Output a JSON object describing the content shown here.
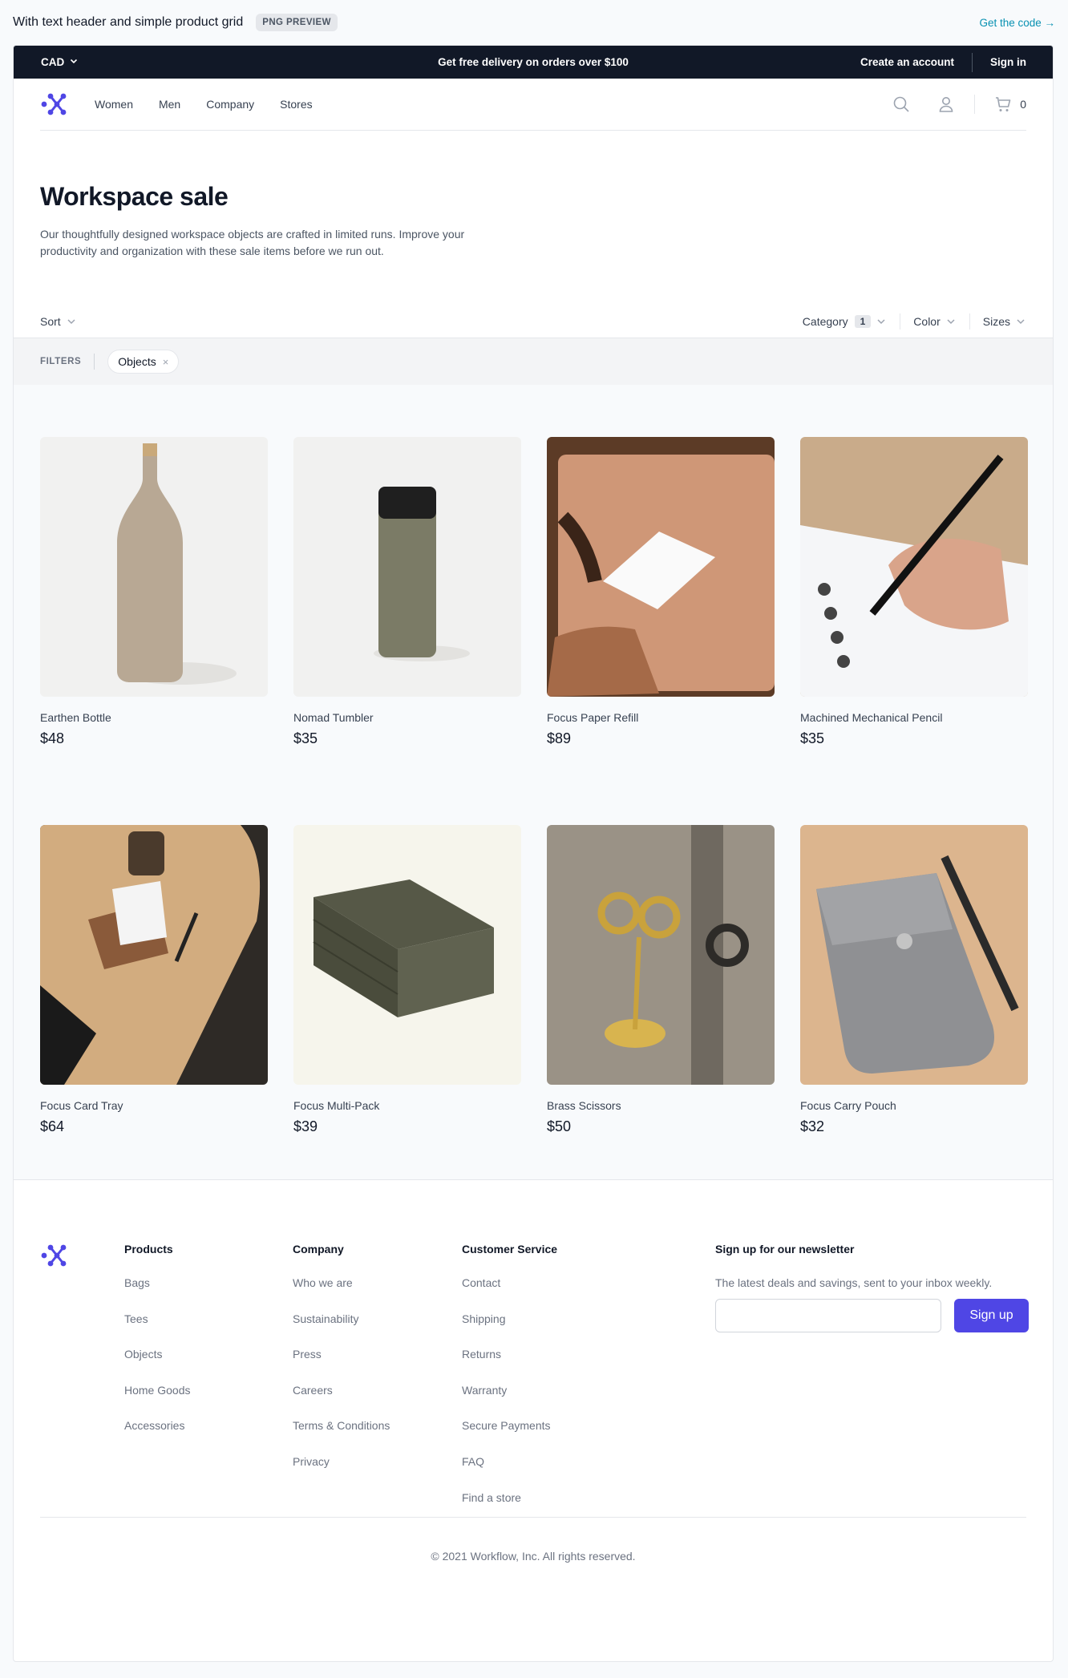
{
  "preview": {
    "title": "With text header and simple product grid",
    "badge": "PNG PREVIEW",
    "code_link": "Get the code →"
  },
  "promo": {
    "currency": "CAD",
    "message": "Get free delivery on orders over $100",
    "create_account": "Create an account",
    "sign_in": "Sign in"
  },
  "nav": {
    "links": [
      "Women",
      "Men",
      "Company",
      "Stores"
    ],
    "cart_count": "0"
  },
  "hero": {
    "title": "Workspace sale",
    "description": "Our thoughtfully designed workspace objects are crafted in limited runs. Improve your productivity and organization with these sale items before we run out."
  },
  "sortbar": {
    "sort": "Sort",
    "category": "Category",
    "category_count": "1",
    "color": "Color",
    "sizes": "Sizes"
  },
  "filters": {
    "label": "FILTERS",
    "active": "Objects",
    "remove": "×"
  },
  "products": [
    {
      "name": "Earthen Bottle",
      "price": "$48"
    },
    {
      "name": "Nomad Tumbler",
      "price": "$35"
    },
    {
      "name": "Focus Paper Refill",
      "price": "$89"
    },
    {
      "name": "Machined Mechanical Pencil",
      "price": "$35"
    },
    {
      "name": "Focus Card Tray",
      "price": "$64"
    },
    {
      "name": "Focus Multi-Pack",
      "price": "$39"
    },
    {
      "name": "Brass Scissors",
      "price": "$50"
    },
    {
      "name": "Focus Carry Pouch",
      "price": "$32"
    }
  ],
  "footer": {
    "products": {
      "title": "Products",
      "items": [
        "Bags",
        "Tees",
        "Objects",
        "Home Goods",
        "Accessories"
      ]
    },
    "company": {
      "title": "Company",
      "items": [
        "Who we are",
        "Sustainability",
        "Press",
        "Careers",
        "Terms & Conditions",
        "Privacy"
      ]
    },
    "service": {
      "title": "Customer Service",
      "items": [
        "Contact",
        "Shipping",
        "Returns",
        "Warranty",
        "Secure Payments",
        "FAQ",
        "Find a store"
      ]
    },
    "newsletter": {
      "title": "Sign up for our newsletter",
      "text": "The latest deals and savings, sent to your inbox weekly.",
      "input_value": "",
      "button": "Sign up"
    },
    "copyright": "© 2021 Workflow, Inc. All rights reserved."
  },
  "colors": {
    "accent": "#4f46e5",
    "dark": "#111827",
    "link": "#0891b2"
  }
}
